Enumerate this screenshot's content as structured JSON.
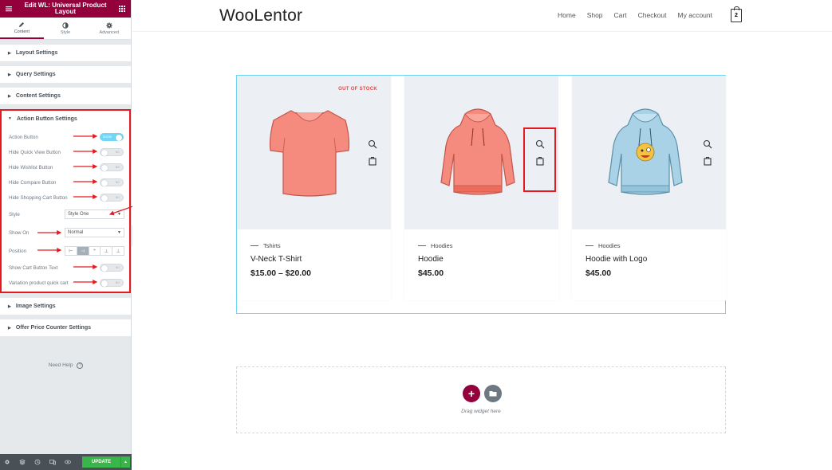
{
  "panel": {
    "title_line1": "Edit WL: Universal Product",
    "title_line2": "Layout",
    "tabs": [
      {
        "label": "Content",
        "icon": "pencil-icon",
        "active": true
      },
      {
        "label": "Style",
        "icon": "contrast-icon",
        "active": false
      },
      {
        "label": "Advanced",
        "icon": "gear-icon",
        "active": false
      }
    ],
    "sections_top": [
      "Layout Settings",
      "Query Settings",
      "Content Settings"
    ],
    "action_section": {
      "title": "Action Button Settings",
      "controls": {
        "action_button": {
          "label": "Action Button",
          "toggle_text": "SHOW",
          "on": true
        },
        "hide_quick_view": {
          "label": "Hide Quick View Button",
          "toggle_text": "NO"
        },
        "hide_wishlist": {
          "label": "Hide Wishlist Button",
          "toggle_text": "NO"
        },
        "hide_compare": {
          "label": "Hide Compare Button",
          "toggle_text": "NO"
        },
        "hide_shopping_cart": {
          "label": "Hide Shopping Cart Button",
          "toggle_text": "NO"
        },
        "style": {
          "label": "Style",
          "value": "Style One"
        },
        "show_on": {
          "label": "Show On",
          "value": "Normal"
        },
        "position": {
          "label": "Position",
          "active_index": 1
        },
        "show_cart_text": {
          "label": "Show Cart Button Text",
          "toggle_text": "NO"
        },
        "variation_quick_cart": {
          "label": "Variation product quick cart",
          "toggle_text": "NO"
        }
      }
    },
    "sections_bottom": [
      "Image Settings",
      "Offer Price Counter Settings"
    ],
    "need_help": "Need Help",
    "update_label": "UPDATE",
    "accent_color": "#93003c",
    "highlight_color": "#e5191f"
  },
  "site": {
    "logo": "WooLentor",
    "nav": [
      "Home",
      "Shop",
      "Cart",
      "Checkout",
      "My account"
    ],
    "cart_count": "2"
  },
  "products": [
    {
      "category": "Tshirts",
      "name": "V-Neck T-Shirt",
      "price": "$15.00 – $20.00",
      "badge": "OUT OF STOCK",
      "image": "tshirt-image"
    },
    {
      "category": "Hoodies",
      "name": "Hoodie",
      "price": "$45.00",
      "badge": "",
      "image": "hoodie-image"
    },
    {
      "category": "Hoodies",
      "name": "Hoodie with Logo",
      "price": "$45.00",
      "badge": "",
      "image": "hoodie-logo-image"
    }
  ],
  "drop_area": {
    "text": "Drag widget here"
  }
}
